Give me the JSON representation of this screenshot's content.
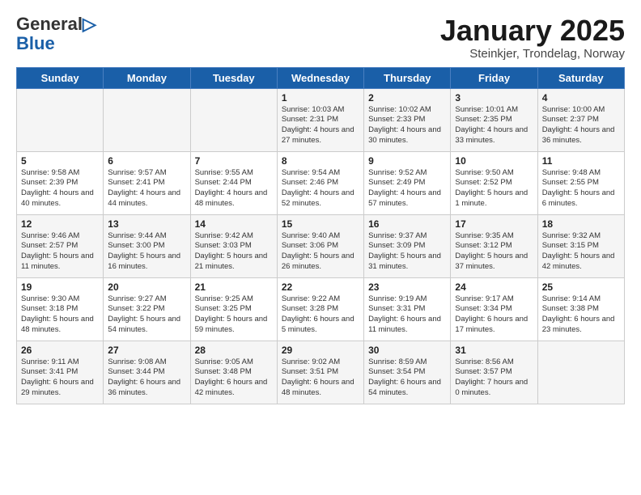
{
  "header": {
    "logo_general": "General",
    "logo_blue": "Blue",
    "title": "January 2025",
    "subtitle": "Steinkjer, Trondelag, Norway"
  },
  "weekdays": [
    "Sunday",
    "Monday",
    "Tuesday",
    "Wednesday",
    "Thursday",
    "Friday",
    "Saturday"
  ],
  "weeks": [
    [
      {
        "day": "",
        "info": ""
      },
      {
        "day": "",
        "info": ""
      },
      {
        "day": "",
        "info": ""
      },
      {
        "day": "1",
        "info": "Sunrise: 10:03 AM\nSunset: 2:31 PM\nDaylight: 4 hours\nand 27 minutes."
      },
      {
        "day": "2",
        "info": "Sunrise: 10:02 AM\nSunset: 2:33 PM\nDaylight: 4 hours\nand 30 minutes."
      },
      {
        "day": "3",
        "info": "Sunrise: 10:01 AM\nSunset: 2:35 PM\nDaylight: 4 hours\nand 33 minutes."
      },
      {
        "day": "4",
        "info": "Sunrise: 10:00 AM\nSunset: 2:37 PM\nDaylight: 4 hours\nand 36 minutes."
      }
    ],
    [
      {
        "day": "5",
        "info": "Sunrise: 9:58 AM\nSunset: 2:39 PM\nDaylight: 4 hours\nand 40 minutes."
      },
      {
        "day": "6",
        "info": "Sunrise: 9:57 AM\nSunset: 2:41 PM\nDaylight: 4 hours\nand 44 minutes."
      },
      {
        "day": "7",
        "info": "Sunrise: 9:55 AM\nSunset: 2:44 PM\nDaylight: 4 hours\nand 48 minutes."
      },
      {
        "day": "8",
        "info": "Sunrise: 9:54 AM\nSunset: 2:46 PM\nDaylight: 4 hours\nand 52 minutes."
      },
      {
        "day": "9",
        "info": "Sunrise: 9:52 AM\nSunset: 2:49 PM\nDaylight: 4 hours\nand 57 minutes."
      },
      {
        "day": "10",
        "info": "Sunrise: 9:50 AM\nSunset: 2:52 PM\nDaylight: 5 hours\nand 1 minute."
      },
      {
        "day": "11",
        "info": "Sunrise: 9:48 AM\nSunset: 2:55 PM\nDaylight: 5 hours\nand 6 minutes."
      }
    ],
    [
      {
        "day": "12",
        "info": "Sunrise: 9:46 AM\nSunset: 2:57 PM\nDaylight: 5 hours\nand 11 minutes."
      },
      {
        "day": "13",
        "info": "Sunrise: 9:44 AM\nSunset: 3:00 PM\nDaylight: 5 hours\nand 16 minutes."
      },
      {
        "day": "14",
        "info": "Sunrise: 9:42 AM\nSunset: 3:03 PM\nDaylight: 5 hours\nand 21 minutes."
      },
      {
        "day": "15",
        "info": "Sunrise: 9:40 AM\nSunset: 3:06 PM\nDaylight: 5 hours\nand 26 minutes."
      },
      {
        "day": "16",
        "info": "Sunrise: 9:37 AM\nSunset: 3:09 PM\nDaylight: 5 hours\nand 31 minutes."
      },
      {
        "day": "17",
        "info": "Sunrise: 9:35 AM\nSunset: 3:12 PM\nDaylight: 5 hours\nand 37 minutes."
      },
      {
        "day": "18",
        "info": "Sunrise: 9:32 AM\nSunset: 3:15 PM\nDaylight: 5 hours\nand 42 minutes."
      }
    ],
    [
      {
        "day": "19",
        "info": "Sunrise: 9:30 AM\nSunset: 3:18 PM\nDaylight: 5 hours\nand 48 minutes."
      },
      {
        "day": "20",
        "info": "Sunrise: 9:27 AM\nSunset: 3:22 PM\nDaylight: 5 hours\nand 54 minutes."
      },
      {
        "day": "21",
        "info": "Sunrise: 9:25 AM\nSunset: 3:25 PM\nDaylight: 5 hours\nand 59 minutes."
      },
      {
        "day": "22",
        "info": "Sunrise: 9:22 AM\nSunset: 3:28 PM\nDaylight: 6 hours\nand 5 minutes."
      },
      {
        "day": "23",
        "info": "Sunrise: 9:19 AM\nSunset: 3:31 PM\nDaylight: 6 hours\nand 11 minutes."
      },
      {
        "day": "24",
        "info": "Sunrise: 9:17 AM\nSunset: 3:34 PM\nDaylight: 6 hours\nand 17 minutes."
      },
      {
        "day": "25",
        "info": "Sunrise: 9:14 AM\nSunset: 3:38 PM\nDaylight: 6 hours\nand 23 minutes."
      }
    ],
    [
      {
        "day": "26",
        "info": "Sunrise: 9:11 AM\nSunset: 3:41 PM\nDaylight: 6 hours\nand 29 minutes."
      },
      {
        "day": "27",
        "info": "Sunrise: 9:08 AM\nSunset: 3:44 PM\nDaylight: 6 hours\nand 36 minutes."
      },
      {
        "day": "28",
        "info": "Sunrise: 9:05 AM\nSunset: 3:48 PM\nDaylight: 6 hours\nand 42 minutes."
      },
      {
        "day": "29",
        "info": "Sunrise: 9:02 AM\nSunset: 3:51 PM\nDaylight: 6 hours\nand 48 minutes."
      },
      {
        "day": "30",
        "info": "Sunrise: 8:59 AM\nSunset: 3:54 PM\nDaylight: 6 hours\nand 54 minutes."
      },
      {
        "day": "31",
        "info": "Sunrise: 8:56 AM\nSunset: 3:57 PM\nDaylight: 7 hours\nand 0 minutes."
      },
      {
        "day": "",
        "info": ""
      }
    ]
  ]
}
